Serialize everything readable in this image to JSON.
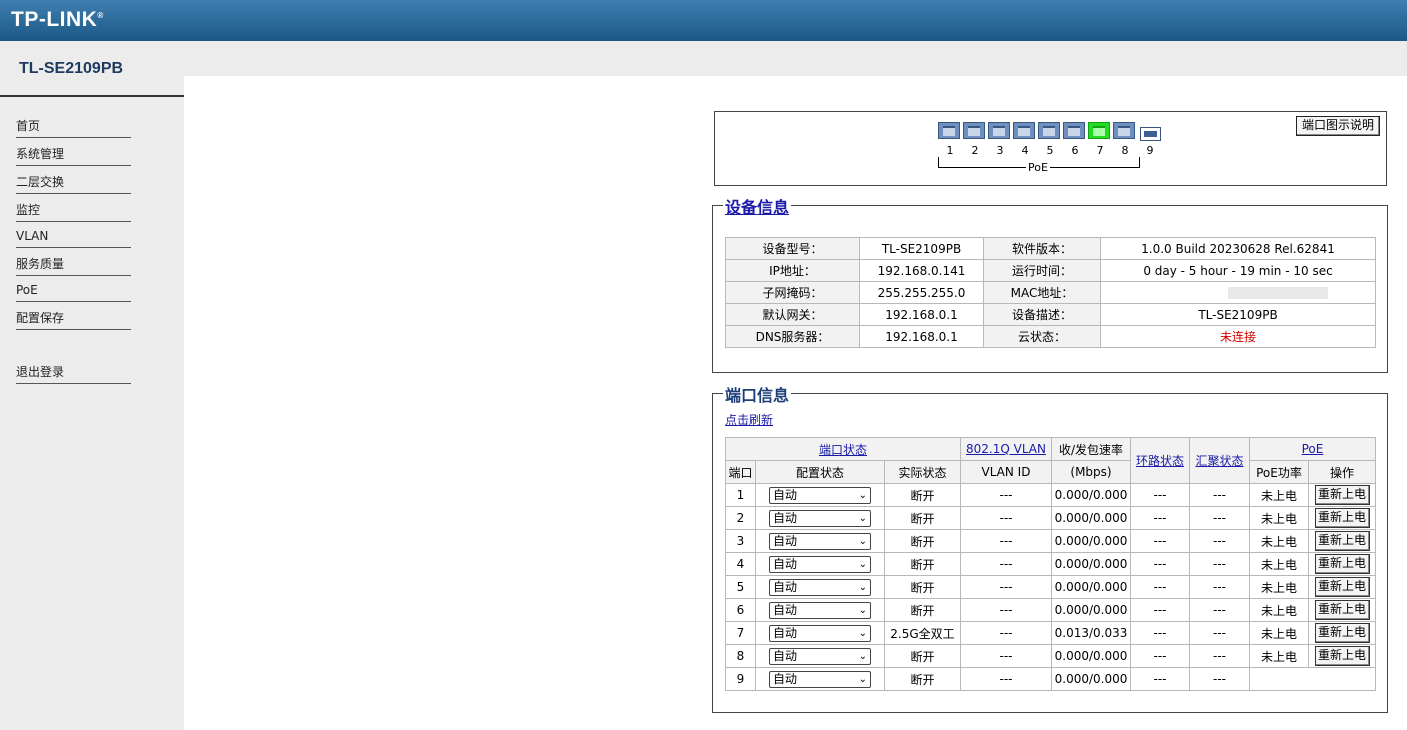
{
  "brand": {
    "logo": "TP-LINK",
    "reg": "®"
  },
  "device_model": "TL-SE2109PB",
  "nav": [
    "首页",
    "系统管理",
    "二层交换",
    "监控",
    "VLAN",
    "服务质量",
    "PoE",
    "配置保存",
    "退出登录"
  ],
  "panel": {
    "legend_button": "端口图示说明",
    "port_numbers": [
      "1",
      "2",
      "3",
      "4",
      "5",
      "6",
      "7",
      "8",
      "9"
    ],
    "port_status": [
      "down",
      "down",
      "down",
      "down",
      "down",
      "down",
      "up",
      "down",
      "sfp"
    ],
    "poe_label": "PoE"
  },
  "device_info": {
    "title": "设备信息",
    "rows": [
      {
        "l1": "设备型号：",
        "v1": "TL-SE2109PB",
        "l2": "软件版本：",
        "v2": "1.0.0 Build 20230628 Rel.62841"
      },
      {
        "l1": "IP地址：",
        "v1": "192.168.0.141",
        "l2": "运行时间：",
        "v2": "0 day - 5 hour - 19 min - 10 sec"
      },
      {
        "l1": "子网掩码：",
        "v1": "255.255.255.0",
        "l2": "MAC地址：",
        "v2": ""
      },
      {
        "l1": "默认网关：",
        "v1": "192.168.0.1",
        "l2": "设备描述：",
        "v2": "TL-SE2109PB"
      },
      {
        "l1": "DNS服务器：",
        "v1": "192.168.0.1",
        "l2": "云状态：",
        "v2": "未连接"
      }
    ],
    "cloud_status_color": "#d00000"
  },
  "port_info": {
    "title": "端口信息",
    "refresh": "点击刷新",
    "headers": {
      "port_status": "端口状态",
      "vlan": "802.1Q VLAN",
      "rate": "收/发包速率",
      "loop": "环路状态",
      "agg": "汇聚状态",
      "poe": "PoE",
      "port": "端口",
      "config": "配置状态",
      "actual": "实际状态",
      "vlan_id": "VLAN ID",
      "mbps": "(Mbps)",
      "poe_power": "PoE功率",
      "op": "操作"
    },
    "rows": [
      {
        "port": "1",
        "config": "自动",
        "actual": "断开",
        "vlan": "---",
        "rate": "0.000/0.000",
        "loop": "---",
        "agg": "---",
        "poe": "未上电",
        "op": "重新上电"
      },
      {
        "port": "2",
        "config": "自动",
        "actual": "断开",
        "vlan": "---",
        "rate": "0.000/0.000",
        "loop": "---",
        "agg": "---",
        "poe": "未上电",
        "op": "重新上电"
      },
      {
        "port": "3",
        "config": "自动",
        "actual": "断开",
        "vlan": "---",
        "rate": "0.000/0.000",
        "loop": "---",
        "agg": "---",
        "poe": "未上电",
        "op": "重新上电"
      },
      {
        "port": "4",
        "config": "自动",
        "actual": "断开",
        "vlan": "---",
        "rate": "0.000/0.000",
        "loop": "---",
        "agg": "---",
        "poe": "未上电",
        "op": "重新上电"
      },
      {
        "port": "5",
        "config": "自动",
        "actual": "断开",
        "vlan": "---",
        "rate": "0.000/0.000",
        "loop": "---",
        "agg": "---",
        "poe": "未上电",
        "op": "重新上电"
      },
      {
        "port": "6",
        "config": "自动",
        "actual": "断开",
        "vlan": "---",
        "rate": "0.000/0.000",
        "loop": "---",
        "agg": "---",
        "poe": "未上电",
        "op": "重新上电"
      },
      {
        "port": "7",
        "config": "自动",
        "actual": "2.5G全双工",
        "vlan": "---",
        "rate": "0.013/0.033",
        "loop": "---",
        "agg": "---",
        "poe": "未上电",
        "op": "重新上电"
      },
      {
        "port": "8",
        "config": "自动",
        "actual": "断开",
        "vlan": "---",
        "rate": "0.000/0.000",
        "loop": "---",
        "agg": "---",
        "poe": "未上电",
        "op": "重新上电"
      },
      {
        "port": "9",
        "config": "自动",
        "actual": "断开",
        "vlan": "---",
        "rate": "0.000/0.000",
        "loop": "---",
        "agg": "---",
        "poe": "",
        "op": ""
      }
    ]
  }
}
